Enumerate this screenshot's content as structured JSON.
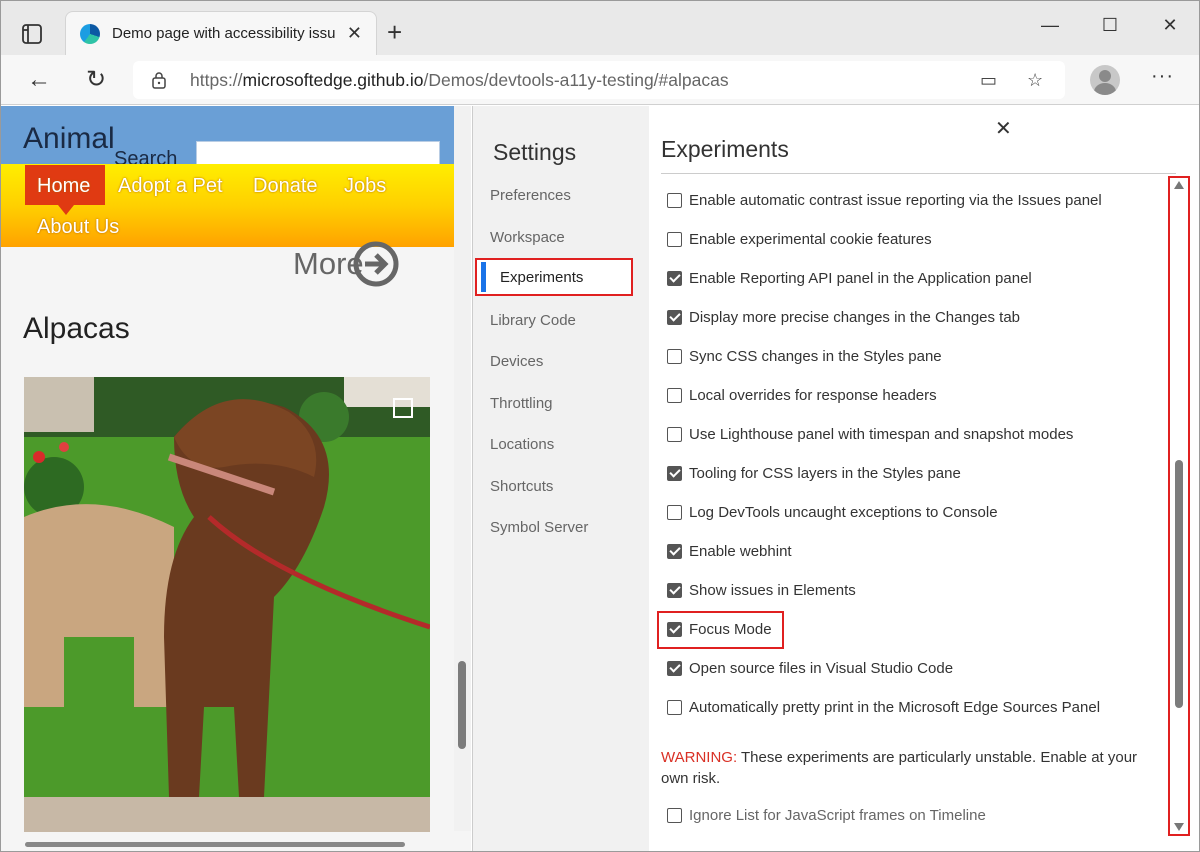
{
  "browser": {
    "tab_title": "Demo page with accessibility issu",
    "url_prefix": "https://",
    "url_domain": "microsoftedge.github.io",
    "url_path": "/Demos/devtools-a11y-testing/#alpacas"
  },
  "webpage": {
    "site_title": "Animal",
    "search_label": "Search",
    "nav": [
      "Home",
      "Adopt a Pet",
      "Donate",
      "Jobs",
      "About Us"
    ],
    "more_label": "More",
    "heading": "Alpacas"
  },
  "settings": {
    "title": "Settings",
    "nav": [
      "Preferences",
      "Workspace",
      "Experiments",
      "Library Code",
      "Devices",
      "Throttling",
      "Locations",
      "Shortcuts",
      "Symbol Server"
    ],
    "active_nav": "Experiments"
  },
  "experiments": {
    "heading": "Experiments",
    "items": [
      {
        "label": "Enable automatic contrast issue reporting via the Issues panel",
        "checked": false
      },
      {
        "label": "Enable experimental cookie features",
        "checked": false
      },
      {
        "label": "Enable Reporting API panel in the Application panel",
        "checked": true
      },
      {
        "label": "Display more precise changes in the Changes tab",
        "checked": true
      },
      {
        "label": "Sync CSS changes in the Styles pane",
        "checked": false
      },
      {
        "label": "Local overrides for response headers",
        "checked": false
      },
      {
        "label": "Use Lighthouse panel with timespan and snapshot modes",
        "checked": false
      },
      {
        "label": "Tooling for CSS layers in the Styles pane",
        "checked": true
      },
      {
        "label": "Log DevTools uncaught exceptions to Console",
        "checked": false
      },
      {
        "label": "Enable webhint",
        "checked": true
      },
      {
        "label": "Show issues in Elements",
        "checked": true
      },
      {
        "label": "Focus Mode",
        "checked": true
      },
      {
        "label": "Open source files in Visual Studio Code",
        "checked": true
      },
      {
        "label": "Automatically pretty print in the Microsoft Edge Sources Panel",
        "checked": false
      }
    ],
    "warning_prefix": "WARNING:",
    "warning_text": " These experiments are particularly unstable. Enable at your own risk.",
    "unstable_items": [
      {
        "label": "Ignore List for JavaScript frames on Timeline",
        "checked": false
      }
    ]
  }
}
